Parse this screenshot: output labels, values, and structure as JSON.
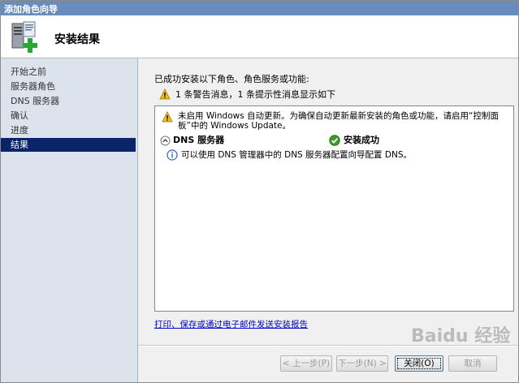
{
  "window": {
    "title": "添加角色向导"
  },
  "header": {
    "page_title": "安装结果",
    "icon": "server-add-icon"
  },
  "sidebar": {
    "items": [
      {
        "label": "开始之前",
        "active": false
      },
      {
        "label": "服务器角色",
        "active": false
      },
      {
        "label": "DNS 服务器",
        "active": false
      },
      {
        "label": "确认",
        "active": false
      },
      {
        "label": "进度",
        "active": false
      },
      {
        "label": "结果",
        "active": true
      }
    ]
  },
  "main": {
    "intro": "已成功安装以下角色、角色服务或功能:",
    "warning_summary": "1 条警告消息，1 条提示性消息显示如下",
    "results": {
      "warning_text": "未启用 Windows 自动更新。为确保自动更新最新安装的角色或功能，请启用“控制面板”中的 Windows Update。",
      "role_name": "DNS 服务器",
      "role_status": "安装成功",
      "info_text": "可以使用 DNS 管理器中的 DNS 服务器配置向导配置 DNS。"
    },
    "report_link": "打印、保存或通过电子邮件发送安装报告"
  },
  "footer": {
    "prev_label": "< 上一步(P)",
    "next_label": "下一步(N) >",
    "close_label": "关闭(O)",
    "cancel_label": "取消"
  },
  "watermark": {
    "text": "Baidu 经验"
  },
  "colors": {
    "titlebar": "#6a8cbc",
    "sidebar_bg": "#dde3ec",
    "sidebar_active": "#0a246a",
    "link": "#0000cc",
    "success": "#3a9a2a",
    "warning": "#f0c020",
    "info": "#2b63b4"
  }
}
